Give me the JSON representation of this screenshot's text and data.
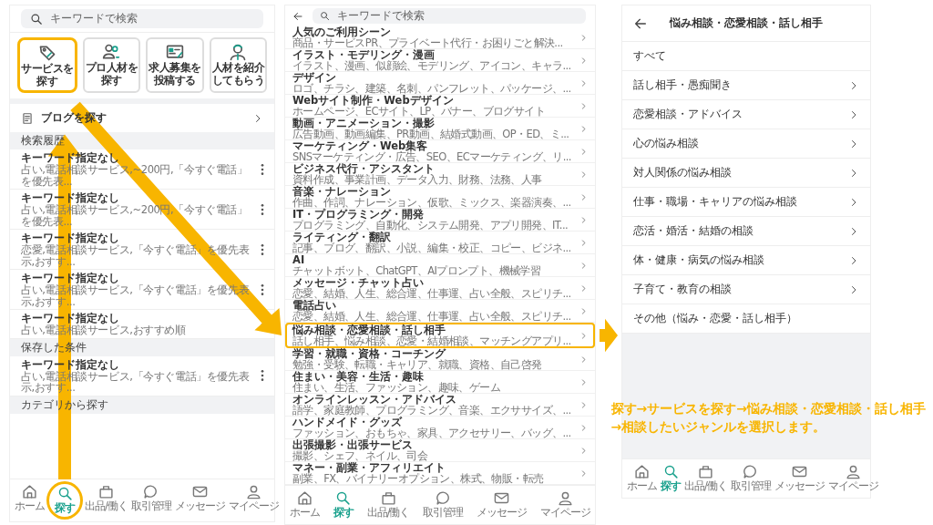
{
  "left_screen": {
    "search": {
      "placeholder": "キーワードで検索"
    },
    "tiles": [
      {
        "lines": [
          "サービスを",
          "探す"
        ],
        "highlighted": true
      },
      {
        "lines": [
          "プロ人材を",
          "探す"
        ],
        "highlighted": false
      },
      {
        "lines": [
          "求人募集を",
          "投稿する"
        ],
        "highlighted": false
      },
      {
        "lines": [
          "人材を紹介",
          "してもらう"
        ],
        "highlighted": false
      }
    ],
    "blog_link": "ブログを探す",
    "sections": [
      {
        "title": "検索履歴",
        "rows": [
          {
            "title": "キーワード指定なし",
            "subtitle": "占い,電話相談サービス,~200円,「今すぐ電話」を優先表..."
          },
          {
            "title": "キーワード指定なし",
            "subtitle": "占い,電話相談サービス,~200円,「今すぐ電話」を優先表..."
          },
          {
            "title": "キーワード指定なし",
            "subtitle": "恋愛,電話相談サービス,「今すぐ電話」を優先表示,おすす..."
          },
          {
            "title": "キーワード指定なし",
            "subtitle": "占い,電話相談サービス,「今すぐ電話」を優先表示,おすす..."
          },
          {
            "title": "キーワード指定なし",
            "subtitle": "占い,電話相談サービス,おすすめ順"
          }
        ]
      },
      {
        "title": "保存した条件",
        "rows": [
          {
            "title": "キーワード指定なし",
            "subtitle": "占い,電話相談サービス,「今すぐ電話」を優先表示,おすす..."
          }
        ]
      },
      {
        "title": "カテゴリから探す"
      }
    ],
    "nav": [
      {
        "label": "ホーム",
        "selected": false,
        "highlighted": false
      },
      {
        "label": "探す",
        "selected": true,
        "highlighted": true
      },
      {
        "label": "出品/働く",
        "selected": false,
        "highlighted": false
      },
      {
        "label": "取引管理",
        "selected": false,
        "highlighted": false
      },
      {
        "label": "メッセージ",
        "selected": false,
        "highlighted": false
      },
      {
        "label": "マイページ",
        "selected": false,
        "highlighted": false
      }
    ]
  },
  "middle_screen": {
    "search": {
      "placeholder": "キーワードで検索"
    },
    "categories": [
      {
        "title": "人気のご利用シーン",
        "subtitle": "商品・サービスPR、プライベート代行・お困りごと解決...",
        "highlighted": false
      },
      {
        "title": "イラスト・モデリング・漫画",
        "subtitle": "イラスト、漫画、似顔絵、モデリング、アイコン、キャラ...",
        "highlighted": false
      },
      {
        "title": "デザイン",
        "subtitle": "ロゴ、チラシ、建築、名刺、パンフレット、パッケージ、...",
        "highlighted": false
      },
      {
        "title": "Webサイト制作・Webデザイン",
        "subtitle": "ホームページ、ECサイト、LP、バナー、ブログサイト",
        "highlighted": false
      },
      {
        "title": "動画・アニメーション・撮影",
        "subtitle": "広告動画、動画編集、PR動画、結婚式動画、OP・ED、ミ...",
        "highlighted": false
      },
      {
        "title": "マーケティング・Web集客",
        "subtitle": "SNSマーケティング・広告、SEO、ECマーケティング、リ...",
        "highlighted": false
      },
      {
        "title": "ビジネス代行・アシスタント",
        "subtitle": "資料作成、事業計画、データ入力、財務、法務、人事",
        "highlighted": false
      },
      {
        "title": "音楽・ナレーション",
        "subtitle": "作曲、作詞、ナレーション、仮歌、ミックス、楽器演奏、...",
        "highlighted": false
      },
      {
        "title": "IT・プログラミング・開発",
        "subtitle": "プログラミング、自動化、システム開発、アプリ開発、IT...",
        "highlighted": false
      },
      {
        "title": "ライティング・翻訳",
        "subtitle": "記事、ブログ、翻訳、小説、編集・校正、コピー、ビジネ...",
        "highlighted": false
      },
      {
        "title": "AI",
        "subtitle": "チャットボット、ChatGPT、AIプロンプト、機械学習",
        "highlighted": false
      },
      {
        "title": "メッセージ・チャット占い",
        "subtitle": "恋愛、結婚、人生、総合運、仕事運、占い全般、スピリチ...",
        "highlighted": false
      },
      {
        "title": "電話占い",
        "subtitle": "恋愛、結婚、人生、総合運、仕事運、占い全般、スピリチ...",
        "highlighted": false
      },
      {
        "title": "悩み相談・恋愛相談・話し相手",
        "subtitle": "話し相手、悩み相談、恋愛・結婚相談、マッチングアプリ...",
        "highlighted": true
      },
      {
        "title": "学習・就職・資格・コーチング",
        "subtitle": "勉強・受験、転職・キャリア、就職、資格、自己啓発",
        "highlighted": false
      },
      {
        "title": "住まい・美容・生活・趣味",
        "subtitle": "住まい、生活、ファッション、趣味、ゲーム",
        "highlighted": false
      },
      {
        "title": "オンラインレッスン・アドバイス",
        "subtitle": "語学、家庭教師、プログラミング、音楽、エクササイズ、...",
        "highlighted": false
      },
      {
        "title": "ハンドメイド・グッズ",
        "subtitle": "ファッション、おもちゃ、家具、アクセサリー、バッグ、...",
        "highlighted": false
      },
      {
        "title": "出張撮影・出張サービス",
        "subtitle": "撮影、シェフ、ネイル、司会",
        "highlighted": false
      },
      {
        "title": "マネー・副業・アフィリエイト",
        "subtitle": "副業、FX、バイナリーオプション、株式、物販・転売",
        "highlighted": false
      }
    ],
    "nav": [
      {
        "label": "ホーム",
        "selected": false
      },
      {
        "label": "探す",
        "selected": true
      },
      {
        "label": "出品/働く",
        "selected": false
      },
      {
        "label": "取引管理",
        "selected": false
      },
      {
        "label": "メッセージ",
        "selected": false
      },
      {
        "label": "マイページ",
        "selected": false
      }
    ]
  },
  "right_screen": {
    "title": "悩み相談・恋愛相談・話し相手",
    "items": [
      {
        "label": "すべて",
        "kind": "plain"
      },
      {
        "label": "話し相手・愚痴聞き",
        "kind": "link"
      },
      {
        "label": "恋愛相談・アドバイス",
        "kind": "link"
      },
      {
        "label": "心の悩み相談",
        "kind": "link"
      },
      {
        "label": "対人関係の悩み相談",
        "kind": "link"
      },
      {
        "label": "仕事・職場・キャリアの悩み相談",
        "kind": "link"
      },
      {
        "label": "恋活・婚活・結婚の相談",
        "kind": "link"
      },
      {
        "label": "体・健康・病気の悩み相談",
        "kind": "link"
      },
      {
        "label": "子育て・教育の相談",
        "kind": "link"
      },
      {
        "label": "その他（悩み・恋愛・話し相手）",
        "kind": "plain"
      }
    ],
    "nav": [
      {
        "label": "ホーム",
        "selected": false
      },
      {
        "label": "探す",
        "selected": true
      },
      {
        "label": "出品/働く",
        "selected": false
      },
      {
        "label": "取引管理",
        "selected": false
      },
      {
        "label": "メッセージ",
        "selected": false
      },
      {
        "label": "マイページ",
        "selected": false
      }
    ]
  },
  "caption": [
    "探す→サービスを探す→悩み相談・恋愛相談・話し相手",
    "→相談したいジャンルを選択します。"
  ]
}
